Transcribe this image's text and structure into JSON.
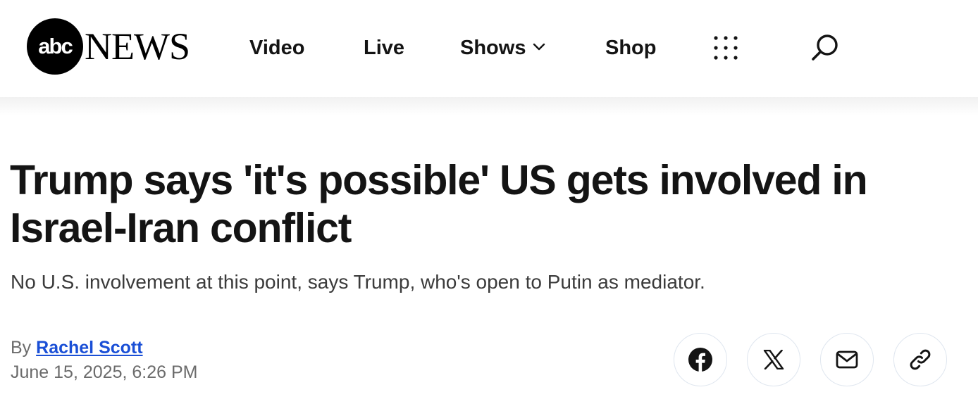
{
  "header": {
    "logo_abc": "abc",
    "logo_news": "NEWS",
    "nav": {
      "video": "Video",
      "live": "Live",
      "shows": "Shows",
      "shop": "Shop"
    }
  },
  "article": {
    "headline": "Trump says 'it's possible' US gets involved in Israel-Iran conflict",
    "subhead": "No U.S. involvement at this point, says Trump, who's open to Putin as mediator.",
    "byline_prefix": "By",
    "author": "Rachel Scott",
    "date": "June 15, 2025, 6:26 PM"
  },
  "share": {
    "icons": [
      "facebook-icon",
      "x-icon",
      "mail-icon",
      "link-icon"
    ]
  },
  "colors": {
    "author_link": "#1a4fd6",
    "text": "#141414",
    "share_border": "#dfe6ef"
  }
}
